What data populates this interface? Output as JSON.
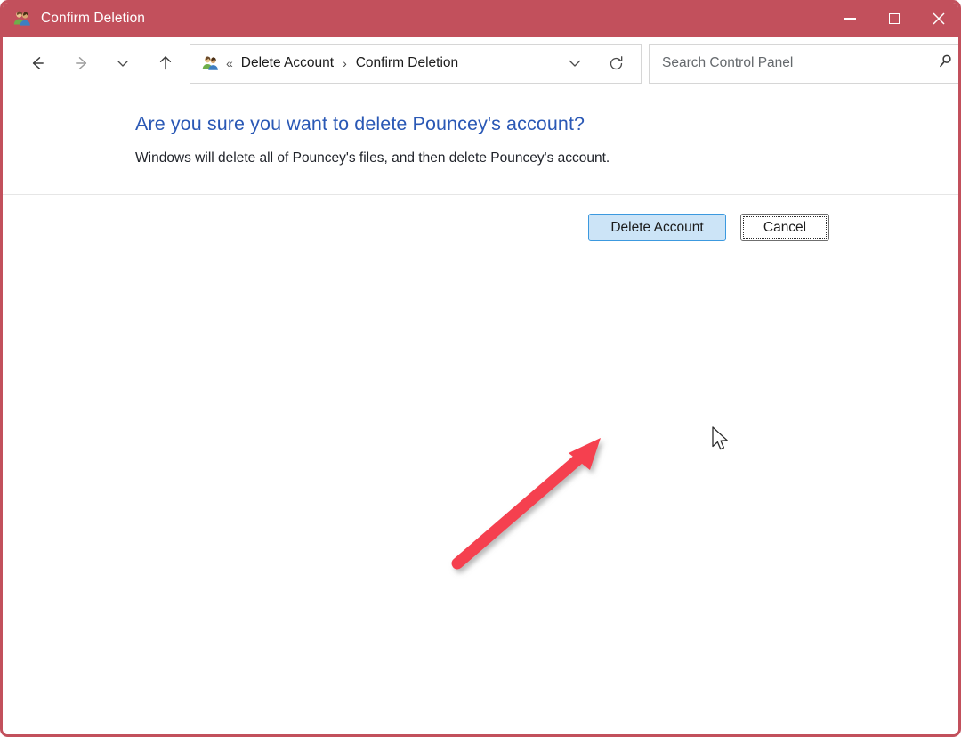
{
  "window": {
    "title": "Confirm Deletion",
    "app_icon": "user-accounts-icon",
    "titlebar_color": "#c2505c",
    "controls": {
      "minimize": "Minimize",
      "maximize": "Maximize",
      "close": "Close"
    }
  },
  "navbar": {
    "back": "Back",
    "forward": "Forward",
    "recent": "Recent locations",
    "up": "Up one level",
    "breadcrumb": {
      "icon": "user-accounts-icon",
      "overflow": "«",
      "items": [
        "Delete Account",
        "Confirm Deletion"
      ],
      "separator": "›"
    },
    "dropdown": "Previous locations",
    "refresh": "Refresh",
    "search": {
      "placeholder": "Search Control Panel",
      "value": "",
      "icon": "search-icon"
    }
  },
  "page": {
    "title": "Are you sure you want to delete Pouncey's account?",
    "title_color": "#2a58b5",
    "description": "Windows will delete all of Pouncey's files, and then delete Pouncey's account."
  },
  "actions": {
    "delete_account": "Delete Account",
    "cancel": "Cancel",
    "primary_fill": "#cce4f7",
    "primary_border": "#3c99df"
  },
  "annotation": {
    "arrow": "red-arrow-annotation",
    "color": "#f5414f",
    "points_to": "Delete Account"
  }
}
